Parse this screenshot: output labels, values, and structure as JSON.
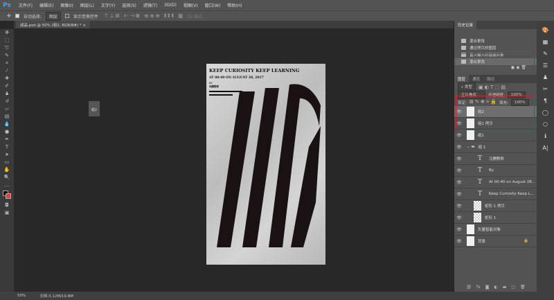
{
  "app": {
    "logo": "Ps"
  },
  "menu": [
    "文件(F)",
    "编辑(E)",
    "图像(I)",
    "图层(L)",
    "文字(Y)",
    "选择(S)",
    "滤镜(T)",
    "3D(D)",
    "视图(V)",
    "窗口(W)",
    "帮助(H)"
  ],
  "options": {
    "auto_select_label": "自动选择:",
    "auto_select_value": "图层",
    "show_transform_label": "显示变换控件",
    "mode_3d": "3D 模式:"
  },
  "document_tab": {
    "title": "成品.psd @ 50% (组2, RGB/8#) *",
    "close": "×"
  },
  "poster": {
    "title": "KEEP CURIOSITY KEEP LEARNING",
    "subtitle": "AT 00:40 ON AUGUST 28, 2017",
    "by": "BY",
    "author": "马腾野郎"
  },
  "floating_panel": {
    "label": "组2"
  },
  "history": {
    "tab": "历史记录",
    "items": [
      {
        "label": "混合更改"
      },
      {
        "label": "通过拷贝的图层"
      },
      {
        "label": "置入嵌入的智能对象"
      },
      {
        "label": "混合更改",
        "active": true
      }
    ]
  },
  "layers_panel": {
    "tabs": [
      "图层",
      "通道",
      "路径"
    ],
    "filter": "类型",
    "blend_mode": "正片叠底",
    "opacity_label": "不透明度:",
    "opacity": "100%",
    "lock_label": "锁定:",
    "fill_label": "填充:",
    "fill": "100%",
    "layers": [
      {
        "name": "组2",
        "kind": "smart",
        "active": true
      },
      {
        "name": "组1 拷贝",
        "kind": "smart"
      },
      {
        "name": "组1",
        "kind": "smart"
      },
      {
        "name": "组 1",
        "kind": "group"
      },
      {
        "name": "马腾野郎",
        "kind": "text"
      },
      {
        "name": "By",
        "kind": "text"
      },
      {
        "name": "At 00:40 on August 28...",
        "kind": "text"
      },
      {
        "name": "Keep Curiosity Keep L...",
        "kind": "text"
      },
      {
        "name": "矩形 1 拷贝",
        "kind": "shape"
      },
      {
        "name": "矩形 1",
        "kind": "shape"
      },
      {
        "name": "矢量智能对象",
        "kind": "smart"
      },
      {
        "name": "背景",
        "kind": "background",
        "locked": true
      }
    ]
  },
  "status": {
    "zoom": "50%",
    "doc": "文档:3.12M/19.8M"
  },
  "colors": {
    "highlight_box": "#d0202a",
    "foreground": "#000000",
    "background": "#e04040"
  }
}
